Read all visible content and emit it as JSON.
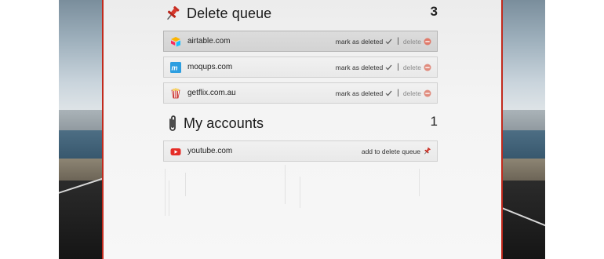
{
  "delete_queue": {
    "title": "Delete queue",
    "count": "3",
    "items": [
      {
        "site": "airtable.com",
        "icon": "airtable-icon",
        "mark_label": "mark as deleted",
        "delete_label": "delete",
        "selected": true
      },
      {
        "site": "moqups.com",
        "icon": "moqups-icon",
        "mark_label": "mark as deleted",
        "delete_label": "delete",
        "selected": false
      },
      {
        "site": "getflix.com.au",
        "icon": "getflix-icon",
        "mark_label": "mark as deleted",
        "delete_label": "delete",
        "selected": false
      }
    ]
  },
  "my_accounts": {
    "title": "My accounts",
    "count": "1",
    "items": [
      {
        "site": "youtube.com",
        "icon": "youtube-icon",
        "action_label": "add to delete queue"
      }
    ]
  },
  "colors": {
    "frame_red": "#c22a1d",
    "pin_red": "#d0342c",
    "delete_icon": "#e07a6a"
  }
}
